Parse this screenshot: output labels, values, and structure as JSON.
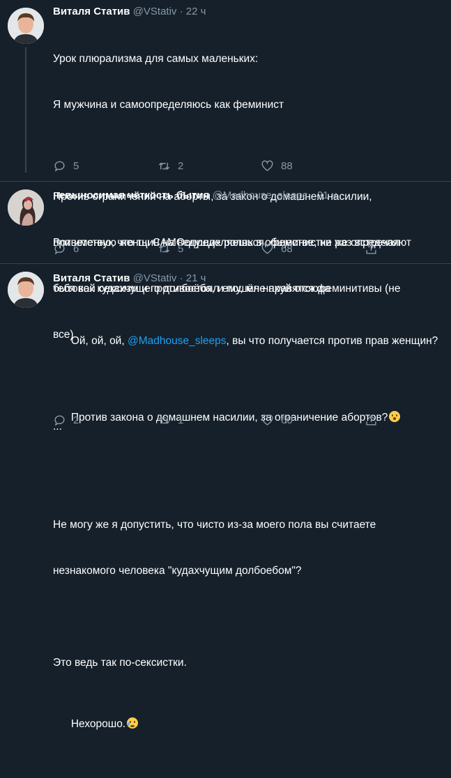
{
  "tweets": [
    {
      "name": "Виталя Статив",
      "handle": "@VStativ",
      "time": "22 ч",
      "lines": [
        "Урок плюрализма для самых маленьких:",
        "Я мужчина и самоопределяюсь как феминист",
        "",
        "Против ограничений на аборты, за закон о домашнем насилии,",
        "приветствую женщин на ведущих ролях в обществе, не раз встречал",
        "бытовой сексизм и противостоял ему, мне нравятся феминитивы (не",
        "все)",
        "",
        "..."
      ],
      "replies": "5",
      "retweets": "2",
      "likes": "88"
    },
    {
      "name": "невыносимая чёткость бытия",
      "handle": "@Madhouse_sleeps",
      "time": "21 ч",
      "lines": [
        "Вот именно, что ты САМОопределяешься, феминистки же определяют",
        "тебя как кудахчущего долбоёба, и пошёл нахуй отсюда"
      ],
      "replies": "6",
      "retweets": "5",
      "likes": "68"
    },
    {
      "name": "Виталя Статив",
      "handle": "@VStativ",
      "time": "21 ч",
      "line1_pre": "Ой, ой, ой, ",
      "line1_mention": "@Madhouse_sleeps",
      "line1_post": ", вы что получается против прав женщин?",
      "line2": "Против закона о домашнем насилии, за ограничение абортов?",
      "line3": "Не могу же я допустить, что чисто из-за моего пола вы считаете",
      "line4": "незнакомого человека \"кудахчущим долбоебом\"?",
      "line5": "Это ведь так по-сексистки.",
      "line6": "Нехорошо.",
      "replies": "2",
      "retweets": "1",
      "likes": "60"
    }
  ],
  "separator": "·",
  "icons": {
    "reply": "reply-icon",
    "retweet": "retweet-icon",
    "like": "heart-icon",
    "share": "share-icon",
    "emoji1": "astonished-face-emoji",
    "emoji2": "crying-face-emoji"
  },
  "colors": {
    "background": "#15202b",
    "text": "#ffffff",
    "secondary": "#8899a6",
    "link": "#1da1f2",
    "border": "#38444d"
  }
}
